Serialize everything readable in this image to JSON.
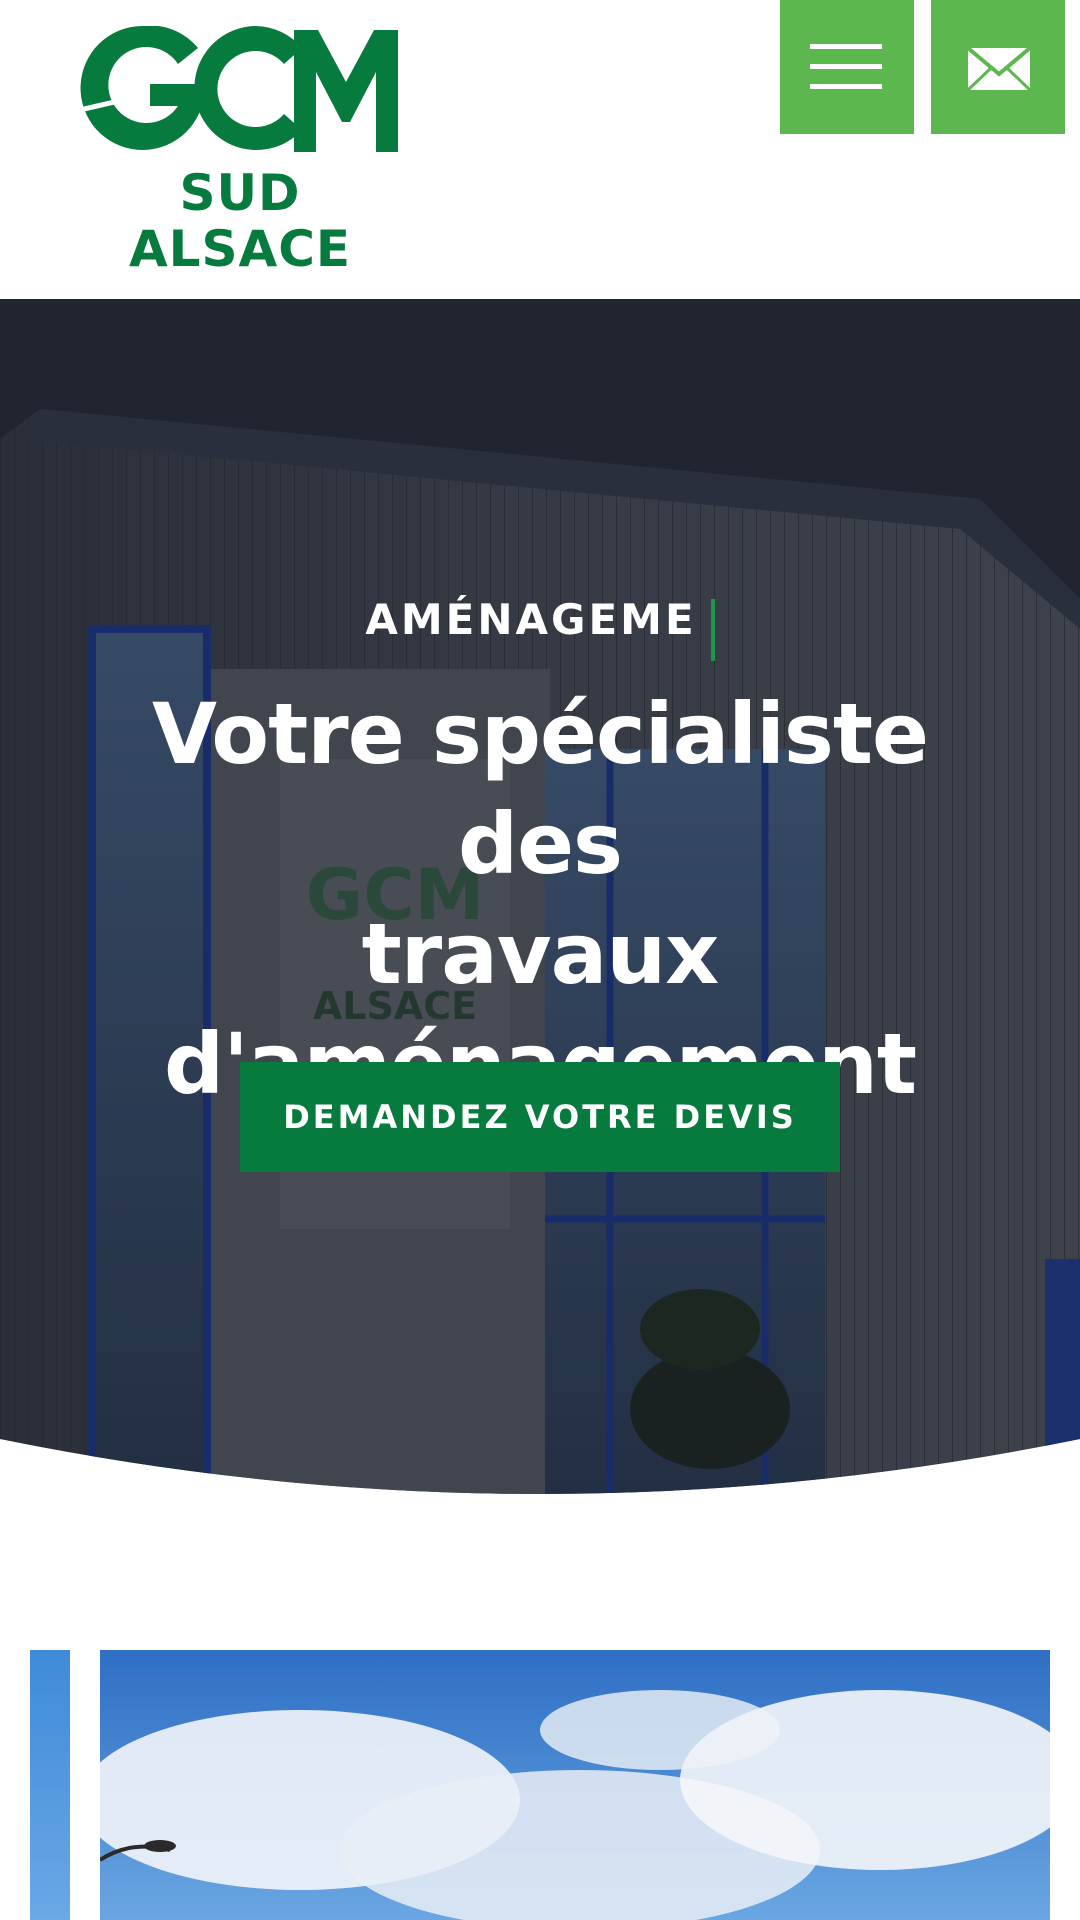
{
  "brand": {
    "line1": "SUD",
    "line2": "ALSACE",
    "color_primary": "#077a3e",
    "color_accent": "#5cb84e"
  },
  "header": {
    "menu_icon": "hamburger-menu-icon",
    "mail_icon": "envelope-icon"
  },
  "hero": {
    "eyebrow": "AMÉNAGEME",
    "headline_lines": [
      "Votre spécialiste des",
      "travaux",
      "d'aménagement"
    ],
    "cta_label": "DEMANDEZ VOTRE DEVIS"
  }
}
